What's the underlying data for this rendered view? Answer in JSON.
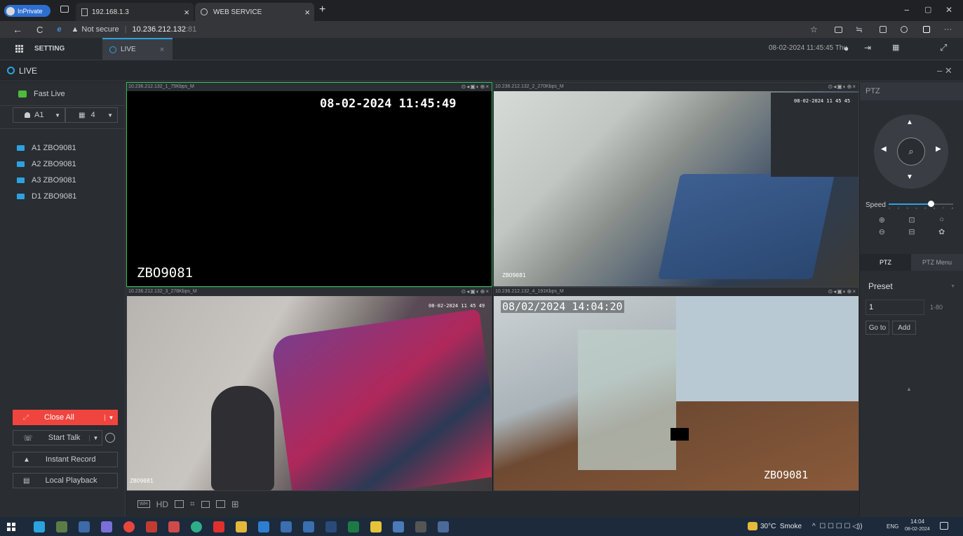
{
  "browser": {
    "profile_label": "InPrivate",
    "tabs": [
      {
        "title": "192.168.1.3",
        "close": "×"
      },
      {
        "title": "WEB SERVICE",
        "close": "×"
      }
    ],
    "new_tab": "+",
    "window_controls": {
      "min": "−",
      "restore": "▢",
      "close": "✕"
    },
    "security_label": "Not secure",
    "url_host": "10.236.212.132",
    "url_port": ":81",
    "more": "···"
  },
  "app": {
    "setting_label": "SETTING",
    "live_tab_label": "LIVE",
    "live_tab_close": "×",
    "datetime": "08-02-2024 11:45:45 Thu",
    "live_title": "LIVE",
    "panel_controls": "– ✕"
  },
  "sidebar": {
    "fast_live": "Fast Live",
    "channel_select": "A1",
    "split_count": "4",
    "cameras": [
      {
        "label": "A1 ZBO9081"
      },
      {
        "label": "A2 ZBO9081"
      },
      {
        "label": "A3 ZBO9081"
      },
      {
        "label": "D1 ZBO9081"
      }
    ],
    "close_all": "Close All",
    "start_talk": "Start Talk",
    "instant_record": "Instant Record",
    "local_playback": "Local Playback"
  },
  "panes": [
    {
      "header": "10.236.212.132_1_75Kbps_M",
      "osd_time": "08-02-2024 11:45:49",
      "osd_name": "ZBO9081"
    },
    {
      "header": "10.236.212.132_2_270Kbps_M",
      "osd_time": "08-02-2024 11 45 45",
      "osd_name": "ZBO9081"
    },
    {
      "header": "10.236.212.132_3_278Kbps_M",
      "osd_time": "08-02-2024 11 45 49",
      "osd_name": "ZBO9081"
    },
    {
      "header": "10.236.212.132_4_191Kbps_M",
      "osd_time": "08/02/2024 14:04:20",
      "osd_name": "ZBO9081"
    }
  ],
  "pane_icons": "⊙◂▣◐⊕×",
  "bottom_toolbar": {
    "hd_label": "HD"
  },
  "ptz": {
    "title": "PTZ",
    "speed_label": "Speed",
    "speed_level": 6,
    "speed_ticks": [
      "1",
      "2",
      "3",
      "4",
      "5",
      "6",
      "7",
      "8"
    ],
    "tab_ptz": "PTZ",
    "tab_ptz_menu": "PTZ Menu",
    "preset_label": "Preset",
    "preset_value": "1",
    "preset_range": "1-80",
    "goto_label": "Go to",
    "add_label": "Add"
  },
  "taskbar": {
    "weather": "30°C  Smoke",
    "tray": "^  ☐ ☐ ☐ ☐ ◁)) ",
    "lang": "ENG",
    "time": "14:04",
    "date": "08-02-2024"
  },
  "colors": {
    "accent": "#2aa3e0",
    "danger": "#f0453e",
    "active_pane": "#34c759"
  }
}
